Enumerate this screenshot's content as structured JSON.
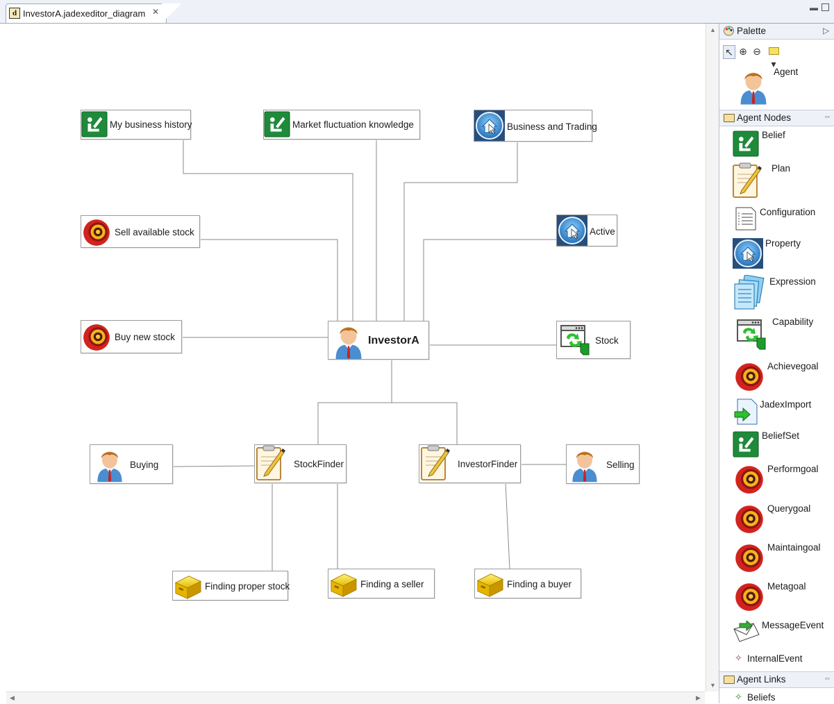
{
  "editor": {
    "tab_title": "InvestorA.jadexeditor_diagram",
    "tab_icon": "d",
    "close_glyph": "✕"
  },
  "diagram": {
    "center": "InvestorA",
    "beliefs": [
      "My business history",
      "Market fluctuation knowledge"
    ],
    "properties": [
      "Business and Trading",
      "Active"
    ],
    "goals": [
      "Sell available stock",
      "Buy new stock"
    ],
    "capability": "Stock",
    "plans": [
      "StockFinder",
      "InvestorFinder"
    ],
    "agents": [
      "Buying",
      "Selling"
    ],
    "messages": [
      "Finding proper stock",
      "Finding a seller",
      "Finding a buyer"
    ]
  },
  "palette": {
    "title": "Palette",
    "agent": "Agent",
    "sections": {
      "nodes": "Agent Nodes",
      "links": "Agent Links"
    },
    "nodes": [
      "Belief",
      "Plan",
      "Configuration",
      "Property",
      "Expression",
      "Capability",
      "Achievegoal",
      "JadexImport",
      "BeliefSet",
      "Performgoal",
      "Querygoal",
      "Maintaingoal",
      "Metagoal",
      "MessageEvent",
      "InternalEvent"
    ],
    "links": [
      "Beliefs"
    ]
  },
  "icons": {
    "belief": "belief-icon",
    "property": "property-icon",
    "goal": "goal-icon",
    "agent": "agent-icon",
    "plan": "plan-icon",
    "capability": "capability-icon",
    "message": "message-event-icon"
  },
  "colors": {
    "belief_green": "#1f8a3a",
    "property_blue": "#2a6fb3",
    "goal_red": "#d2231f",
    "message_yellow": "#f2c40f",
    "palette_header": "#eef1f7"
  }
}
